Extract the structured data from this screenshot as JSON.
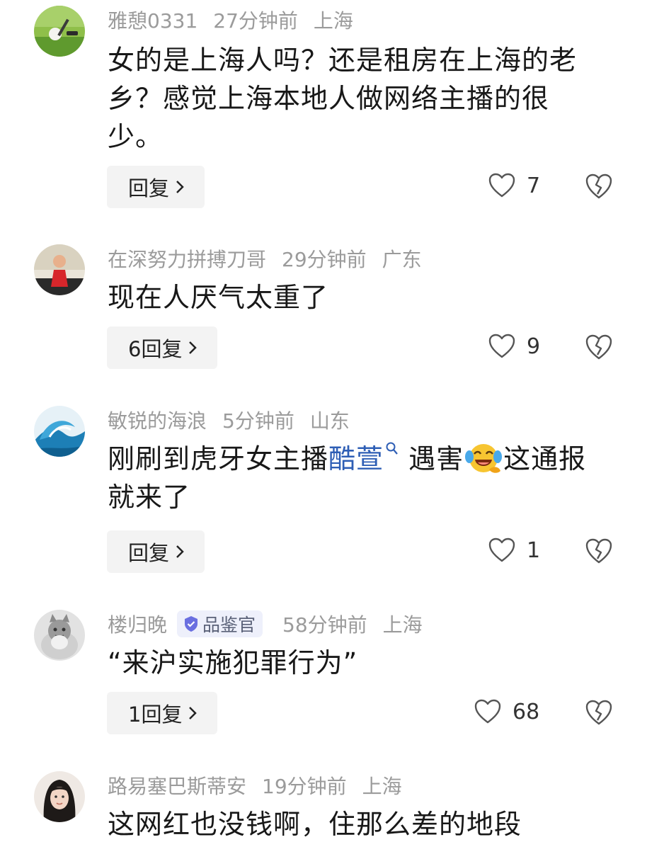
{
  "comments": [
    {
      "username": "雅憩0331",
      "time": "27分钟前",
      "location": "上海",
      "text_line1": "女的是上海人吗？还是租房在上海的老",
      "text_line2": "乡？感觉上海本地人做网络主播的很",
      "text_line3": "少。",
      "reply_label": "回复",
      "likes": "7"
    },
    {
      "username": "在深努力拼搏刀哥",
      "time": "29分钟前",
      "location": "广东",
      "text_line1": "现在人厌气太重了",
      "reply_label": "6回复",
      "likes": "9"
    },
    {
      "username": "敏锐的海浪",
      "time": "5分钟前",
      "location": "山东",
      "text_before": "刚刷到虎牙女主播",
      "link_text": "酷萱",
      "text_after": "遇害",
      "text_end": "这通报",
      "text_line2": "就来了",
      "reply_label": "回复",
      "likes": "1"
    },
    {
      "username": "楼归晚",
      "badge": "品鉴官",
      "time": "58分钟前",
      "location": "上海",
      "text_line1": "“来沪实施犯罪行为”",
      "reply_label": "1回复",
      "likes": "68"
    },
    {
      "username": "路易塞巴斯蒂安",
      "time": "19分钟前",
      "location": "上海",
      "text_line1": "这网红也没钱啊，住那么差的地段"
    }
  ],
  "colors": {
    "meta_gray": "#9b9b9b",
    "link_blue": "#2e5eb5",
    "badge_bg": "#eef0fb",
    "reply_bg": "#f3f3f3"
  },
  "icons": {
    "like": "heart-outline-icon",
    "dislike": "broken-heart-icon",
    "search_link": "search-icon",
    "emoji": "laughing-crying-emoji",
    "badge": "verified-shield-icon"
  }
}
